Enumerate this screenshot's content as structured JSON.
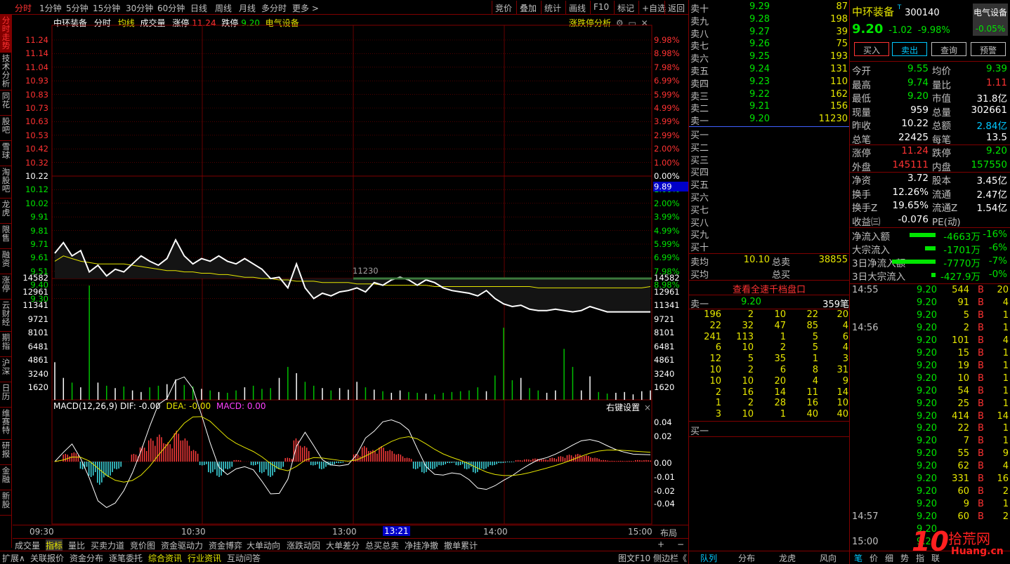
{
  "toolbar": {
    "periods": [
      "分时",
      "1分钟",
      "5分钟",
      "15分钟",
      "30分钟",
      "60分钟",
      "日线",
      "周线",
      "月线",
      "多分时",
      "更多 >"
    ],
    "buttons": [
      "竞价",
      "叠加",
      "统计",
      "画线",
      "F10",
      "标记",
      "+自选",
      "返回"
    ]
  },
  "left_tabs": [
    "分时走势",
    "技术分析",
    "同花",
    "股吧",
    "雪球",
    "淘股吧",
    "龙虎",
    "限售",
    "融资",
    "涨停",
    "云财经",
    "期指",
    "沪深",
    "日历",
    "维赛特",
    "研报",
    "金融",
    "新股"
  ],
  "chart_header": {
    "name": "中环装备",
    "mode": "分时",
    "avg_label": "均线",
    "vol_label": "成交量",
    "limit_up_label": "涨停",
    "limit_up": "11.24",
    "limit_down_label": "跌停",
    "limit_down": "9.20",
    "sector": "电气设备",
    "analysis": "涨跌停分析"
  },
  "macd_header": {
    "title": "MACD(12,26,9)",
    "dif": "DIF: -0.00",
    "dea": "DEA: -0.00",
    "macd": "MACD: 0.00",
    "right_setting": "右键设置"
  },
  "price_axis": {
    "left": [
      "11.24",
      "11.14",
      "11.04",
      "10.93",
      "10.83",
      "10.73",
      "10.63",
      "10.53",
      "10.42",
      "10.32",
      "10.22",
      "10.12",
      "10.02",
      "9.91",
      "9.81",
      "9.71",
      "9.61",
      "9.51",
      "9.40",
      "9.30"
    ],
    "right": [
      "9.98%",
      "8.98%",
      "7.98%",
      "6.99%",
      "5.99%",
      "4.99%",
      "3.99%",
      "2.99%",
      "2.00%",
      "1.00%",
      "0.00%",
      "1.00%",
      "2.00%",
      "3.99%",
      "4.99%",
      "5.99%",
      "6.99%",
      "7.98%",
      "8.98%"
    ],
    "current_tag": "9.89"
  },
  "volume_axis": [
    "14582",
    "12961",
    "11341",
    "9721",
    "8101",
    "6481",
    "4861",
    "3240",
    "1620"
  ],
  "macd_axis": [
    "0.04",
    "0.02",
    "0.00",
    "-0.01",
    "-0.02",
    "-0.04"
  ],
  "time_axis": [
    "09:30",
    "10:30",
    "13:00",
    "13:21",
    "14:00",
    "15:00"
  ],
  "cursor_volume_label": "11230",
  "layout_label": "布局",
  "bottom_tabs1": [
    "成交量",
    "指标",
    "量比",
    "买卖力道",
    "竞价图",
    "资金驱动力",
    "资金博弈",
    "大单动向",
    "涨跌动因",
    "大单差分",
    "总买总卖",
    "净挂净撤",
    "撤单累计"
  ],
  "bottom_tabs2": [
    "扩展∧",
    "关联报价",
    "资金分布",
    "逐笔委托",
    "综合资讯",
    "行业资讯",
    "互动问答"
  ],
  "bottom_right_labels": [
    "图文F10",
    "侧边栏《"
  ],
  "orderbook": {
    "asks": [
      {
        "label": "卖十",
        "price": "9.29",
        "vol": "87"
      },
      {
        "label": "卖九",
        "price": "9.28",
        "vol": "198"
      },
      {
        "label": "卖八",
        "price": "9.27",
        "vol": "39"
      },
      {
        "label": "卖七",
        "price": "9.26",
        "vol": "75"
      },
      {
        "label": "卖六",
        "price": "9.25",
        "vol": "193"
      },
      {
        "label": "卖五",
        "price": "9.24",
        "vol": "131"
      },
      {
        "label": "卖四",
        "price": "9.23",
        "vol": "110"
      },
      {
        "label": "卖三",
        "price": "9.22",
        "vol": "162"
      },
      {
        "label": "卖二",
        "price": "9.21",
        "vol": "156"
      },
      {
        "label": "卖一",
        "price": "9.20",
        "vol": "11230"
      }
    ],
    "bids": [
      "买一",
      "买二",
      "买三",
      "买四",
      "买五",
      "买六",
      "买七",
      "买八",
      "买九",
      "买十"
    ],
    "avg_ask_label": "卖均",
    "avg_ask": "10.10",
    "total_ask_label": "总卖",
    "total_ask": "38855",
    "avg_bid_label": "买均",
    "total_bid_label": "总买",
    "view_all": "查看全速千档盘口",
    "queue_label": "卖一",
    "queue_price": "9.20",
    "queue_count": "359笔",
    "queue": [
      [
        "196",
        "2",
        "10",
        "22",
        "20"
      ],
      [
        "22",
        "32",
        "47",
        "85",
        "4"
      ],
      [
        "241",
        "113",
        "1",
        "5",
        "6"
      ],
      [
        "6",
        "10",
        "2",
        "5",
        "4"
      ],
      [
        "12",
        "5",
        "35",
        "1",
        "3"
      ],
      [
        "10",
        "2",
        "6",
        "8",
        "31"
      ],
      [
        "10",
        "10",
        "20",
        "4",
        "9"
      ],
      [
        "2",
        "16",
        "14",
        "11",
        "14"
      ],
      [
        "1",
        "2",
        "28",
        "16",
        "10"
      ],
      [
        "3",
        "10",
        "1",
        "40",
        "40"
      ]
    ],
    "bid_queue_label": "买一",
    "bottom_tabs": [
      "队列",
      "分布",
      "龙虎",
      "风向"
    ]
  },
  "quote": {
    "name": "中环装备",
    "code": "300140",
    "sector_btn": "电气设备",
    "sector_chg": "-0.05%",
    "price": "9.20",
    "change": "-1.02",
    "pct": "-9.98%",
    "buttons": [
      "买入",
      "卖出",
      "查询",
      "预警"
    ],
    "rows": [
      {
        "k1": "今开",
        "v1": "9.55",
        "c1": "green",
        "k2": "均价",
        "v2": "9.39",
        "c2": "green"
      },
      {
        "k1": "最高",
        "v1": "9.74",
        "c1": "green",
        "k2": "量比",
        "v2": "1.11",
        "c2": "red"
      },
      {
        "k1": "最低",
        "v1": "9.20",
        "c1": "green",
        "k2": "市值",
        "v2": "31.8亿",
        "c2": "white"
      },
      {
        "k1": "现量",
        "v1": "959",
        "c1": "white",
        "k2": "总量",
        "v2": "302661",
        "c2": "white"
      },
      {
        "k1": "昨收",
        "v1": "10.22",
        "c1": "white",
        "k2": "总额",
        "v2": "2.84亿",
        "c2": "cyan"
      },
      {
        "k1": "总笔",
        "v1": "22425",
        "c1": "white",
        "k2": "每笔",
        "v2": "13.5",
        "c2": "white"
      }
    ],
    "rows2": [
      {
        "k1": "涨停",
        "v1": "11.24",
        "c1": "red",
        "k2": "跌停",
        "v2": "9.20",
        "c2": "green"
      },
      {
        "k1": "外盘",
        "v1": "145111",
        "c1": "red",
        "k2": "内盘",
        "v2": "157550",
        "c2": "green"
      }
    ],
    "rows3": [
      {
        "k1": "净资",
        "v1": "3.72",
        "c1": "white",
        "k2": "股本",
        "v2": "3.45亿",
        "c2": "white"
      },
      {
        "k1": "换手",
        "v1": "12.26%",
        "c1": "white",
        "k2": "流通",
        "v2": "2.47亿",
        "c2": "white"
      },
      {
        "k1": "换手Z",
        "v1": "19.65%",
        "c1": "white",
        "k2": "流通Z",
        "v2": "1.54亿",
        "c2": "white"
      },
      {
        "k1": "收益㈢",
        "v1": "-0.076",
        "c1": "white",
        "k2": "PE(动)",
        "v2": "",
        "c2": "white"
      }
    ],
    "flows": [
      {
        "label": "净流入额",
        "value": "-4663万",
        "pct": "-16%",
        "bar": 0.6
      },
      {
        "label": "大宗流入",
        "value": "-1701万",
        "pct": "-6%",
        "bar": 0.25
      },
      {
        "label": "3日净流入额",
        "value": "-7770万",
        "pct": "-7%",
        "bar": 1.0
      },
      {
        "label": "3日大宗流入",
        "value": "-427.9万",
        "pct": "-0%",
        "bar": 0.1
      }
    ],
    "ticks": [
      {
        "t": "14:55",
        "p": "9.20",
        "v": "544",
        "bs": "B",
        "n": "20"
      },
      {
        "t": "",
        "p": "9.20",
        "v": "91",
        "bs": "B",
        "n": "4"
      },
      {
        "t": "",
        "p": "9.20",
        "v": "5",
        "bs": "B",
        "n": "1"
      },
      {
        "t": "14:56",
        "p": "9.20",
        "v": "2",
        "bs": "B",
        "n": "1"
      },
      {
        "t": "",
        "p": "9.20",
        "v": "101",
        "bs": "B",
        "n": "4"
      },
      {
        "t": "",
        "p": "9.20",
        "v": "15",
        "bs": "B",
        "n": "1"
      },
      {
        "t": "",
        "p": "9.20",
        "v": "19",
        "bs": "B",
        "n": "1"
      },
      {
        "t": "",
        "p": "9.20",
        "v": "10",
        "bs": "B",
        "n": "1"
      },
      {
        "t": "",
        "p": "9.20",
        "v": "54",
        "bs": "B",
        "n": "1"
      },
      {
        "t": "",
        "p": "9.20",
        "v": "25",
        "bs": "B",
        "n": "1"
      },
      {
        "t": "",
        "p": "9.20",
        "v": "414",
        "bs": "B",
        "n": "14"
      },
      {
        "t": "",
        "p": "9.20",
        "v": "22",
        "bs": "B",
        "n": "1"
      },
      {
        "t": "",
        "p": "9.20",
        "v": "7",
        "bs": "B",
        "n": "1"
      },
      {
        "t": "",
        "p": "9.20",
        "v": "55",
        "bs": "B",
        "n": "9"
      },
      {
        "t": "",
        "p": "9.20",
        "v": "62",
        "bs": "B",
        "n": "4"
      },
      {
        "t": "",
        "p": "9.20",
        "v": "331",
        "bs": "B",
        "n": "16"
      },
      {
        "t": "",
        "p": "9.20",
        "v": "60",
        "bs": "B",
        "n": "2"
      },
      {
        "t": "",
        "p": "9.20",
        "v": "9",
        "bs": "B",
        "n": "1"
      },
      {
        "t": "14:57",
        "p": "9.20",
        "v": "60",
        "bs": "B",
        "n": "2"
      },
      {
        "t": "",
        "p": "9.20",
        "v": "",
        "bs": "",
        "n": ""
      },
      {
        "t": "15:00",
        "p": "9.20",
        "v": "",
        "bs": "",
        "n": ""
      }
    ],
    "bottom_tabs": [
      "笔",
      "价",
      "细",
      "势",
      "指",
      "联"
    ]
  },
  "watermark": "10 拾荒网 Huang.cn",
  "chart_data": {
    "type": "line",
    "x_range": [
      "09:30",
      "15:00"
    ],
    "prev_close": 10.22,
    "ylim": [
      9.2,
      11.24
    ],
    "price_series": [
      9.64,
      9.72,
      9.62,
      9.66,
      9.5,
      9.55,
      9.47,
      9.52,
      9.5,
      9.56,
      9.62,
      9.58,
      9.55,
      9.6,
      9.74,
      9.62,
      9.56,
      9.6,
      9.58,
      9.62,
      9.58,
      9.56,
      9.6,
      9.56,
      9.52,
      9.45,
      9.46,
      9.38,
      9.56,
      9.38,
      9.3,
      9.34,
      9.32,
      9.35,
      9.36,
      9.38,
      9.35,
      9.42,
      9.4,
      9.44,
      9.46,
      9.44,
      9.4,
      9.44,
      9.42,
      9.38,
      9.36,
      9.35,
      9.34,
      9.32,
      9.36,
      9.3,
      9.26,
      9.24,
      9.25,
      9.22,
      9.21,
      9.21,
      9.22,
      9.21,
      9.2,
      9.21,
      9.24,
      9.22,
      9.2,
      9.2,
      9.2,
      9.2,
      9.2,
      9.2
    ],
    "avg_series": [
      9.58,
      9.62,
      9.6,
      9.58,
      9.57,
      9.56,
      9.56,
      9.56,
      9.56,
      9.55,
      9.54,
      9.53,
      9.52,
      9.51,
      9.51,
      9.5,
      9.5,
      9.49,
      9.49,
      9.48,
      9.48,
      9.47,
      9.46,
      9.46,
      9.45,
      9.45,
      9.44,
      9.44,
      9.43,
      9.43,
      9.43,
      9.42,
      9.42,
      9.42,
      9.42,
      9.41,
      9.41,
      9.41,
      9.4,
      9.4,
      9.4,
      9.4,
      9.4,
      9.4,
      9.39,
      9.39,
      9.39,
      9.39,
      9.39,
      9.39,
      9.39,
      9.39,
      9.39,
      9.39,
      9.39,
      9.39,
      9.38,
      9.38,
      9.38,
      9.38,
      9.38,
      9.38,
      9.38,
      9.38,
      9.38,
      9.38,
      9.38,
      9.38,
      9.38,
      9.39
    ],
    "volume_series": [
      4800,
      2800,
      2200,
      1600,
      14582,
      2200,
      1800,
      1500,
      1700,
      1200,
      1000,
      1600,
      1800,
      2000,
      2600,
      1900,
      1700,
      1400,
      1200,
      1000,
      900,
      1200,
      1600,
      1800,
      1400,
      1500,
      2800,
      4200,
      3400,
      2300,
      1800,
      1500,
      1200,
      1500,
      1300,
      2300,
      1600,
      1300,
      1100,
      900,
      1200,
      1000,
      900,
      800,
      700,
      900,
      1000,
      1100,
      1200,
      1600,
      1100,
      3100,
      9200,
      2500,
      2800,
      1500,
      1200,
      900,
      1200,
      6500,
      4200,
      1200,
      3000,
      1000,
      800,
      900,
      1000,
      700,
      1100,
      1200
    ],
    "macd_series": [
      0.0,
      0.01,
      0.012,
      -0.01,
      -0.02,
      -0.03,
      -0.02,
      -0.01,
      0.0,
      0.01,
      0.02,
      0.03,
      0.035,
      0.025,
      0.04,
      0.03,
      0.015,
      -0.005,
      -0.015,
      -0.02,
      -0.01,
      0.002,
      0.0,
      -0.005,
      -0.015,
      -0.02,
      -0.01,
      0.005,
      0.03,
      0.02,
      -0.005,
      -0.01,
      -0.005,
      -0.002,
      0.0,
      0.01,
      0.02,
      0.015,
      0.02,
      0.015,
      0.01,
      0.005,
      -0.01,
      -0.015,
      -0.01,
      -0.005,
      -0.002,
      -0.005,
      -0.01,
      -0.015,
      -0.01,
      -0.005,
      -0.002,
      -0.001,
      0.002,
      0.003,
      0.004,
      0.003,
      0.005,
      0.007,
      0.009,
      0.01,
      0.008,
      0.005,
      0.002,
      0.001,
      0.001,
      0.001,
      0.002,
      0.002
    ]
  }
}
